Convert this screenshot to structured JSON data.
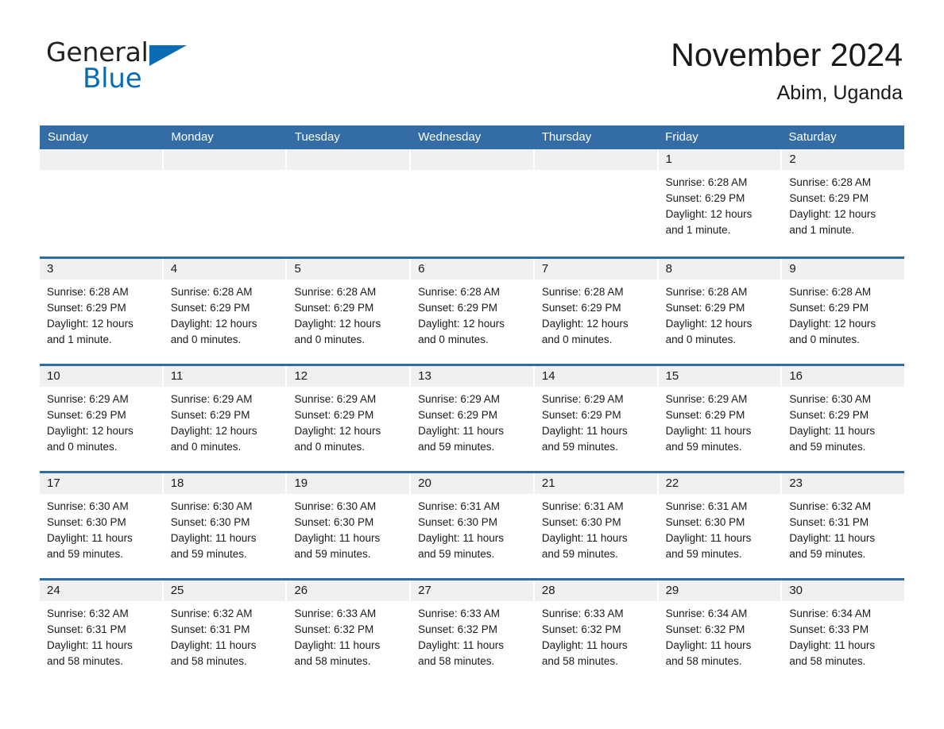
{
  "brand": {
    "name_part1": "General",
    "name_part2": "Blue",
    "logo_shape": "triangle-icon",
    "accent_color": "#0a6cb4"
  },
  "header": {
    "title": "November 2024",
    "subtitle": "Abim, Uganda"
  },
  "colors": {
    "header_blue": "#346DA6",
    "row_divider_blue": "#2E6DA4",
    "date_band_gray": "#F0F0F0"
  },
  "calendar": {
    "weekday_headers": [
      "Sunday",
      "Monday",
      "Tuesday",
      "Wednesday",
      "Thursday",
      "Friday",
      "Saturday"
    ],
    "weeks": [
      [
        {
          "day": "",
          "empty": true
        },
        {
          "day": "",
          "empty": true
        },
        {
          "day": "",
          "empty": true
        },
        {
          "day": "",
          "empty": true
        },
        {
          "day": "",
          "empty": true
        },
        {
          "day": "1",
          "sunrise": "Sunrise: 6:28 AM",
          "sunset": "Sunset: 6:29 PM",
          "daylight1": "Daylight: 12 hours",
          "daylight2": "and 1 minute."
        },
        {
          "day": "2",
          "sunrise": "Sunrise: 6:28 AM",
          "sunset": "Sunset: 6:29 PM",
          "daylight1": "Daylight: 12 hours",
          "daylight2": "and 1 minute."
        }
      ],
      [
        {
          "day": "3",
          "sunrise": "Sunrise: 6:28 AM",
          "sunset": "Sunset: 6:29 PM",
          "daylight1": "Daylight: 12 hours",
          "daylight2": "and 1 minute."
        },
        {
          "day": "4",
          "sunrise": "Sunrise: 6:28 AM",
          "sunset": "Sunset: 6:29 PM",
          "daylight1": "Daylight: 12 hours",
          "daylight2": "and 0 minutes."
        },
        {
          "day": "5",
          "sunrise": "Sunrise: 6:28 AM",
          "sunset": "Sunset: 6:29 PM",
          "daylight1": "Daylight: 12 hours",
          "daylight2": "and 0 minutes."
        },
        {
          "day": "6",
          "sunrise": "Sunrise: 6:28 AM",
          "sunset": "Sunset: 6:29 PM",
          "daylight1": "Daylight: 12 hours",
          "daylight2": "and 0 minutes."
        },
        {
          "day": "7",
          "sunrise": "Sunrise: 6:28 AM",
          "sunset": "Sunset: 6:29 PM",
          "daylight1": "Daylight: 12 hours",
          "daylight2": "and 0 minutes."
        },
        {
          "day": "8",
          "sunrise": "Sunrise: 6:28 AM",
          "sunset": "Sunset: 6:29 PM",
          "daylight1": "Daylight: 12 hours",
          "daylight2": "and 0 minutes."
        },
        {
          "day": "9",
          "sunrise": "Sunrise: 6:28 AM",
          "sunset": "Sunset: 6:29 PM",
          "daylight1": "Daylight: 12 hours",
          "daylight2": "and 0 minutes."
        }
      ],
      [
        {
          "day": "10",
          "sunrise": "Sunrise: 6:29 AM",
          "sunset": "Sunset: 6:29 PM",
          "daylight1": "Daylight: 12 hours",
          "daylight2": "and 0 minutes."
        },
        {
          "day": "11",
          "sunrise": "Sunrise: 6:29 AM",
          "sunset": "Sunset: 6:29 PM",
          "daylight1": "Daylight: 12 hours",
          "daylight2": "and 0 minutes."
        },
        {
          "day": "12",
          "sunrise": "Sunrise: 6:29 AM",
          "sunset": "Sunset: 6:29 PM",
          "daylight1": "Daylight: 12 hours",
          "daylight2": "and 0 minutes."
        },
        {
          "day": "13",
          "sunrise": "Sunrise: 6:29 AM",
          "sunset": "Sunset: 6:29 PM",
          "daylight1": "Daylight: 11 hours",
          "daylight2": "and 59 minutes."
        },
        {
          "day": "14",
          "sunrise": "Sunrise: 6:29 AM",
          "sunset": "Sunset: 6:29 PM",
          "daylight1": "Daylight: 11 hours",
          "daylight2": "and 59 minutes."
        },
        {
          "day": "15",
          "sunrise": "Sunrise: 6:29 AM",
          "sunset": "Sunset: 6:29 PM",
          "daylight1": "Daylight: 11 hours",
          "daylight2": "and 59 minutes."
        },
        {
          "day": "16",
          "sunrise": "Sunrise: 6:30 AM",
          "sunset": "Sunset: 6:29 PM",
          "daylight1": "Daylight: 11 hours",
          "daylight2": "and 59 minutes."
        }
      ],
      [
        {
          "day": "17",
          "sunrise": "Sunrise: 6:30 AM",
          "sunset": "Sunset: 6:30 PM",
          "daylight1": "Daylight: 11 hours",
          "daylight2": "and 59 minutes."
        },
        {
          "day": "18",
          "sunrise": "Sunrise: 6:30 AM",
          "sunset": "Sunset: 6:30 PM",
          "daylight1": "Daylight: 11 hours",
          "daylight2": "and 59 minutes."
        },
        {
          "day": "19",
          "sunrise": "Sunrise: 6:30 AM",
          "sunset": "Sunset: 6:30 PM",
          "daylight1": "Daylight: 11 hours",
          "daylight2": "and 59 minutes."
        },
        {
          "day": "20",
          "sunrise": "Sunrise: 6:31 AM",
          "sunset": "Sunset: 6:30 PM",
          "daylight1": "Daylight: 11 hours",
          "daylight2": "and 59 minutes."
        },
        {
          "day": "21",
          "sunrise": "Sunrise: 6:31 AM",
          "sunset": "Sunset: 6:30 PM",
          "daylight1": "Daylight: 11 hours",
          "daylight2": "and 59 minutes."
        },
        {
          "day": "22",
          "sunrise": "Sunrise: 6:31 AM",
          "sunset": "Sunset: 6:30 PM",
          "daylight1": "Daylight: 11 hours",
          "daylight2": "and 59 minutes."
        },
        {
          "day": "23",
          "sunrise": "Sunrise: 6:32 AM",
          "sunset": "Sunset: 6:31 PM",
          "daylight1": "Daylight: 11 hours",
          "daylight2": "and 59 minutes."
        }
      ],
      [
        {
          "day": "24",
          "sunrise": "Sunrise: 6:32 AM",
          "sunset": "Sunset: 6:31 PM",
          "daylight1": "Daylight: 11 hours",
          "daylight2": "and 58 minutes."
        },
        {
          "day": "25",
          "sunrise": "Sunrise: 6:32 AM",
          "sunset": "Sunset: 6:31 PM",
          "daylight1": "Daylight: 11 hours",
          "daylight2": "and 58 minutes."
        },
        {
          "day": "26",
          "sunrise": "Sunrise: 6:33 AM",
          "sunset": "Sunset: 6:32 PM",
          "daylight1": "Daylight: 11 hours",
          "daylight2": "and 58 minutes."
        },
        {
          "day": "27",
          "sunrise": "Sunrise: 6:33 AM",
          "sunset": "Sunset: 6:32 PM",
          "daylight1": "Daylight: 11 hours",
          "daylight2": "and 58 minutes."
        },
        {
          "day": "28",
          "sunrise": "Sunrise: 6:33 AM",
          "sunset": "Sunset: 6:32 PM",
          "daylight1": "Daylight: 11 hours",
          "daylight2": "and 58 minutes."
        },
        {
          "day": "29",
          "sunrise": "Sunrise: 6:34 AM",
          "sunset": "Sunset: 6:32 PM",
          "daylight1": "Daylight: 11 hours",
          "daylight2": "and 58 minutes."
        },
        {
          "day": "30",
          "sunrise": "Sunrise: 6:34 AM",
          "sunset": "Sunset: 6:33 PM",
          "daylight1": "Daylight: 11 hours",
          "daylight2": "and 58 minutes."
        }
      ]
    ]
  }
}
